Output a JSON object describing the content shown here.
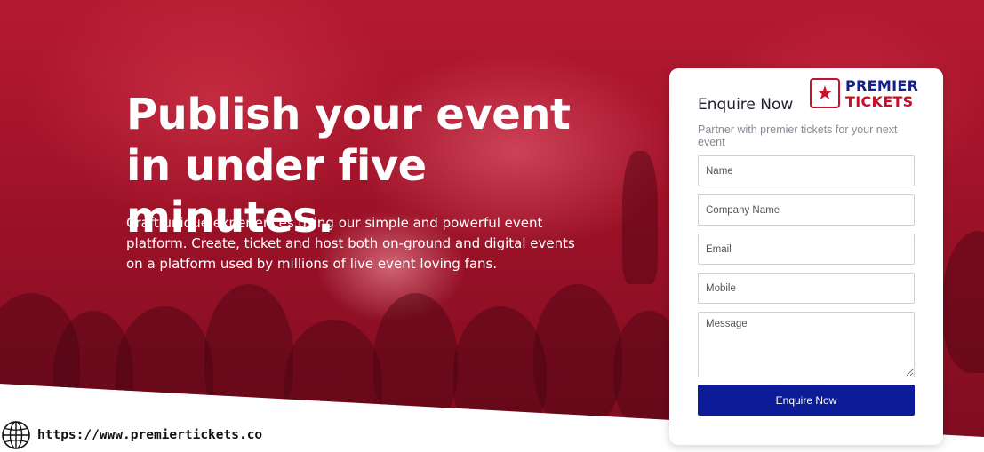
{
  "hero": {
    "headline": "Publish your event in under five minutes.",
    "subtext": "Craft unique experiences using our simple and powerful event platform. Create, ticket and host both on-ground and digital events on a platform used by millions of live event loving fans.",
    "background_color": "#9e1228"
  },
  "enquiry_form": {
    "title": "Enquire Now",
    "subtitle": "Partner with premier tickets for your next event",
    "fields": {
      "name_placeholder": "Name",
      "company_placeholder": "Company Name",
      "email_placeholder": "Email",
      "mobile_placeholder": "Mobile",
      "message_placeholder": "Message"
    },
    "submit_label": "Enquire Now",
    "submit_color": "#0c1c98"
  },
  "logo": {
    "line1": "PREMIER",
    "line2": "TICKETS",
    "icon": "star-ticket-icon",
    "primary_color": "#14208c",
    "accent_color": "#c8102e"
  },
  "footer": {
    "icon": "globe-icon",
    "url": "https://www.premiertickets.co"
  }
}
